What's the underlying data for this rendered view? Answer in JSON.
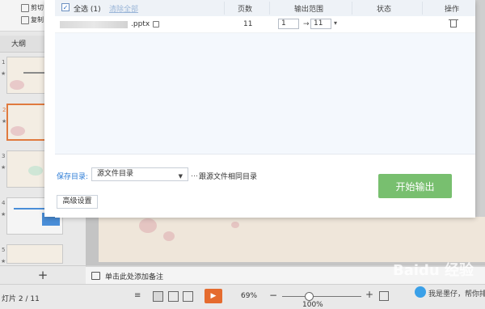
{
  "app": {
    "toolbar_top": "剪切",
    "toolbar_second": "复制",
    "outline_tab": "大纲",
    "thumb_numbers": [
      "1",
      "2",
      "3",
      "4",
      "5"
    ],
    "notes_placeholder": "单击此处添加备注",
    "status_slide": "灯片 2 / 11",
    "zoom": "69%",
    "zoom_bottom": "100%",
    "ai_hint": "我是墨仔，帮你排",
    "watermark": "Baidu 经验"
  },
  "dialog": {
    "header": {
      "select_all": "全选 (1)",
      "clear_all": "清除全部",
      "pages": "页数",
      "output_range": "输出范围",
      "status": "状态",
      "actions": "操作"
    },
    "rows": [
      {
        "file_suffix": ".pptx",
        "pages": "11",
        "range_from": "1",
        "range_arrow": "→",
        "range_to": "11"
      }
    ],
    "footer": {
      "save_label": "保存目录:",
      "save_value": "源文件目录",
      "save_more": "…",
      "save_hint": "跟源文件相同目录",
      "advanced_btn": "高级设置",
      "start_btn": "开始输出"
    }
  },
  "colors": {
    "accent_blue": "#2b7bd6",
    "start_green": "#78bf6f",
    "play_orange": "#e56b2e",
    "active_slide_border": "#e07a3f"
  }
}
